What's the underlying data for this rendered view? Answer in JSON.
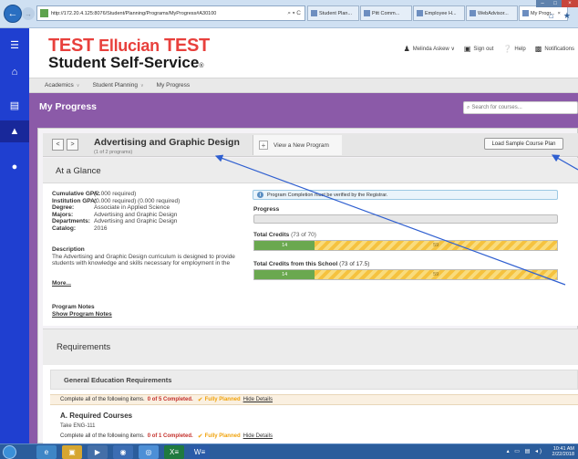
{
  "browser": {
    "url": "http://172.20.4.125:8076/Student/Planning/Programs/MyProgress#A30100",
    "addr_tools": "⌕ ▾ C",
    "tabs": [
      {
        "label": "Student Plan...",
        "active": false
      },
      {
        "label": "Pitt Comm...",
        "active": false
      },
      {
        "label": "Employee H...",
        "active": false
      },
      {
        "label": "WebAdvisor...",
        "active": false
      },
      {
        "label": "My Progr...",
        "active": true
      }
    ],
    "tab_close": "×",
    "win_min": "–",
    "win_max": "□",
    "win_close": "×",
    "toolbar_icons": "⌂ ★"
  },
  "header": {
    "logo_line1_a": "TEST ",
    "logo_line1_b": "Ellucian",
    "logo_line1_c": " TEST",
    "logo_line2": "Student Self-Service",
    "logo_dot": "®",
    "user_name": "Melinda Askew",
    "user_chevron": "∨",
    "sign_out": "Sign out",
    "help": "Help",
    "notifications": "Notifications"
  },
  "breadcrumb": {
    "items": [
      "Academics",
      "Student Planning",
      "My Progress"
    ],
    "chevron": "∨"
  },
  "page": {
    "title": "My Progress",
    "search_placeholder": "Search for courses...",
    "search_icon": "⌕"
  },
  "program": {
    "prev_arrow": "<",
    "next_arrow": ">",
    "title": "Advertising and Graphic Design",
    "subtitle": "(1 of 2 programs)",
    "new_program": "View a New Program",
    "plus": "+",
    "load_sample": "Load Sample Course Plan"
  },
  "glance": {
    "title": "At a Glance",
    "rows": [
      {
        "k": "Cumulative GPA:",
        "v": "(2.000 required)"
      },
      {
        "k": "Institution GPA:",
        "v": "(0.000 required) (0.000 required)"
      },
      {
        "k": "Degree:",
        "v": "Associate in Applied Science"
      },
      {
        "k": "Majors:",
        "v": "Advertising and Graphic Design"
      },
      {
        "k": "Departments:",
        "v": "Advertising and Graphic Design"
      },
      {
        "k": "Catalog:",
        "v": "2016"
      }
    ],
    "description_label": "Description",
    "description": "The Advertising and Graphic Design curriculum is designed to provide students with knowledge and skills necessary for employment in the",
    "more": "More...",
    "notes_label": "Program Notes",
    "notes_link": "Show Program Notes",
    "verify_text": "Program Completion must be verified by the Registrar.",
    "info_icon": "i",
    "progress_label": "Progress",
    "total_credits_label": "Total Credits",
    "total_credits_count": "(73 of 70)",
    "total_credits_done": "14",
    "total_credits_planned": "59",
    "total_credits_done_fraction": 0.2,
    "school_credits_label": "Total Credits from this School",
    "school_credits_count": "(73 of 17.5)",
    "school_credits_done": "14",
    "school_credits_planned": "59",
    "school_credits_done_fraction": 0.2
  },
  "requirements": {
    "title": "Requirements",
    "general_title": "General Education Requirements",
    "line1_text": "Complete all of the following items.",
    "line1_count": "0 of 5 Completed.",
    "fully_planned": "Fully Planned",
    "hide_details": "Hide Details",
    "check_icon": "✔",
    "sub_title": "A.  Required Courses",
    "take": "Take ENG-111",
    "line2_text": "Complete all of the following items.",
    "line2_count": "0 of 1 Completed."
  },
  "taskbar": {
    "time": "10:41 AM",
    "date": "2/22/2018",
    "tray_icons": "▴ ▭ ▤ ◂)",
    "excel_label": "X≡",
    "word_label": "W≡"
  },
  "colors": {
    "sidebar": "#1f3fd0",
    "band": "#8b5aa8",
    "logo_red": "#e8403c",
    "done_green": "#6aa84f",
    "planned_yellow": "#f5c23f",
    "arrow_blue": "#2f5fd0"
  }
}
